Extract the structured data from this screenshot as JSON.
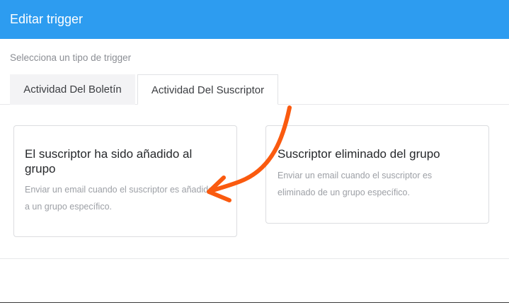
{
  "header": {
    "title": "Editar trigger"
  },
  "trigger_type": {
    "label": "Selecciona un tipo de trigger",
    "tabs": [
      {
        "label": "Actividad Del Boletín",
        "active": false
      },
      {
        "label": "Actividad Del Suscriptor",
        "active": true
      }
    ]
  },
  "options": [
    {
      "title": "El suscriptor ha sido añadido al grupo",
      "description": "Enviar un email cuando el suscriptor es añadido a un grupo específico."
    },
    {
      "title": "Suscriptor eliminado del grupo",
      "description": "Enviar un email cuando el suscriptor es eliminado de un grupo específico."
    }
  ],
  "colors": {
    "header_bg": "#2d9cf0",
    "annotation_arrow": "#fa5a0f"
  },
  "icons": [
    "annotation-arrow-icon"
  ]
}
